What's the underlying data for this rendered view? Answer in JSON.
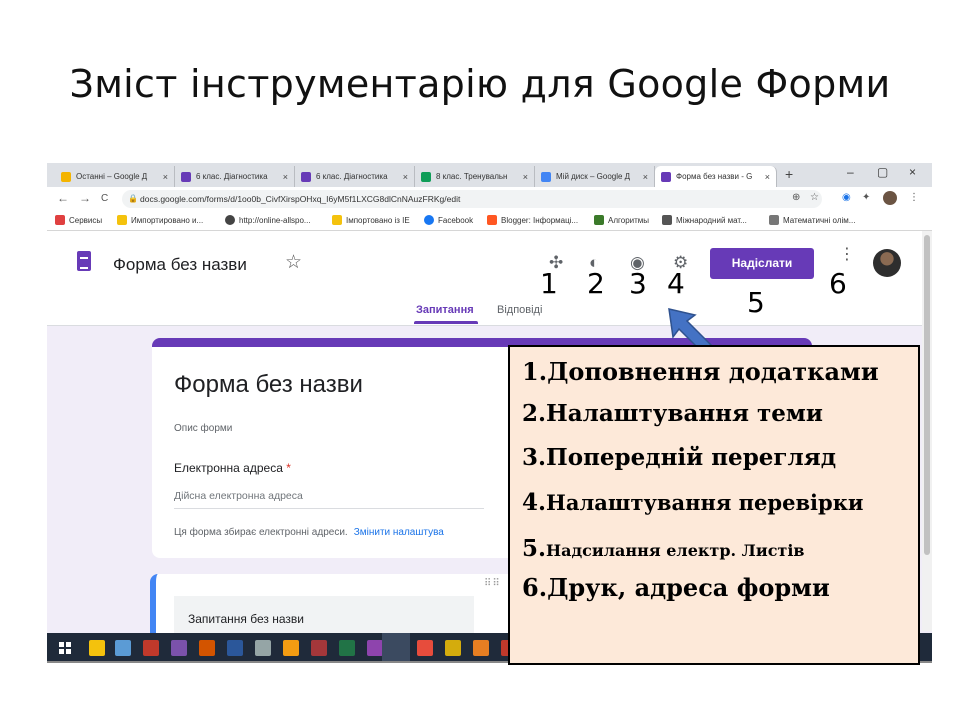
{
  "slide": {
    "title": "Зміст інструментарію для Google Форми"
  },
  "browser": {
    "tabs": [
      {
        "label": "Останні – Google Д",
        "color": "#f4b400"
      },
      {
        "label": "6 клас. Діагностика",
        "color": "#673ab7"
      },
      {
        "label": "6 клас. Діагностика",
        "color": "#673ab7"
      },
      {
        "label": "8 клас. Тренувальн",
        "color": "#0f9d58"
      },
      {
        "label": "Мій диск – Google Д",
        "color": "#4285f4"
      },
      {
        "label": "Форма без назви - G",
        "color": "#673ab7"
      }
    ],
    "tab_close": "×",
    "new_tab": "+",
    "window_controls": [
      "–",
      "▢",
      "×"
    ],
    "nav": {
      "back": "←",
      "forward": "→",
      "reload": "C"
    },
    "url": "docs.google.com/forms/d/1oo0b_CivfXirspOHxq_I6yM5f1LXCG8dlCnNAuzFRKg/edit",
    "lock": "🔒",
    "nav_icons": [
      "⊕",
      "☆",
      "◉",
      "✦",
      "⋮"
    ],
    "bookmarks": [
      {
        "label": "Сервисы",
        "color": "#e04040"
      },
      {
        "label": "Импортировано и...",
        "color": "#f4c20d"
      },
      {
        "label": "http://online-allspo...",
        "color": "#444444"
      },
      {
        "label": "Імпортовано із IE",
        "color": "#f4c20d"
      },
      {
        "label": "Facebook",
        "color": "#1877f2"
      },
      {
        "label": "Blogger: Інформаці...",
        "color": "#ff5722"
      },
      {
        "label": "Алгоритмы",
        "color": "#3b7a2a"
      },
      {
        "label": "Міжнародний мат...",
        "color": "#555555"
      },
      {
        "label": "Математичні олім...",
        "color": "#777777"
      }
    ]
  },
  "forms_header": {
    "form_name": "Форма без назви",
    "star": "☆",
    "icons": [
      "✣",
      "◐",
      "◉",
      "⚙"
    ],
    "send_label": "Надіслати",
    "kebab": "⋮",
    "numbers": [
      "1",
      "2",
      "3",
      "4",
      "5",
      "6"
    ],
    "tabs": [
      "Запитання",
      "Відповіді"
    ]
  },
  "form": {
    "title": "Форма без назви",
    "description": "Опис форми",
    "email_label": "Електронна адреса",
    "required_mark": "*",
    "email_placeholder": "Дійсна електронна адреса",
    "note": "Ця форма збирає електронні адреси.",
    "note_link": "Змінити налаштува",
    "drag_handle": "⠿⠿",
    "question_placeholder": "Запитання без назви"
  },
  "legend": {
    "items": [
      {
        "n": "1.",
        "text": "Доповнення додатками"
      },
      {
        "n": "2.",
        "text": "Налаштування теми"
      },
      {
        "n": "3.",
        "text": "Попередній перегляд"
      },
      {
        "n": "4.",
        "text": "Налаштування перевірки"
      },
      {
        "n": "5.",
        "text": "Надсилання електр. Листів"
      },
      {
        "n": "6.",
        "text": "Друк, адреса форми"
      }
    ]
  },
  "colors": {
    "accent": "#673ab7",
    "arrow": "#4472c4",
    "legend_bg": "#fde9d9"
  }
}
